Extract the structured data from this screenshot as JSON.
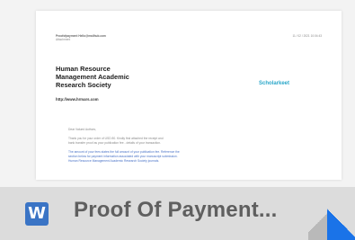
{
  "preview": {
    "header_from": "Proofofpayment Hello@mailhub.com",
    "header_to": "Attachment",
    "header_date": "11 / 02 / 2021 10:04:43",
    "org_lines": [
      "Human Resource",
      "Management Academic",
      "Research Society"
    ],
    "org_url": "http://www.hrmars.com",
    "logo_text": "Scholarkeet",
    "greeting": "Dear Valued Authors,",
    "para1": "Thank you for your order of USD 80. Kindly find attached the receipt and",
    "para1b": "bank transfer proof as your publication fee - details of your transaction.",
    "para2": "The amount of your fees states the full amount of your publication fee. Reference the",
    "para2b": "section below for payment information associated with your manuscript submission.",
    "para2c": "Human Resource Management Academic Research Society journals."
  },
  "file": {
    "icon_letter": "W",
    "name": "Proof Of Payment..."
  },
  "colors": {
    "word_blue": "#3a74c5",
    "corner_blue": "#1a73e8",
    "logo": "#2aa7c9"
  }
}
